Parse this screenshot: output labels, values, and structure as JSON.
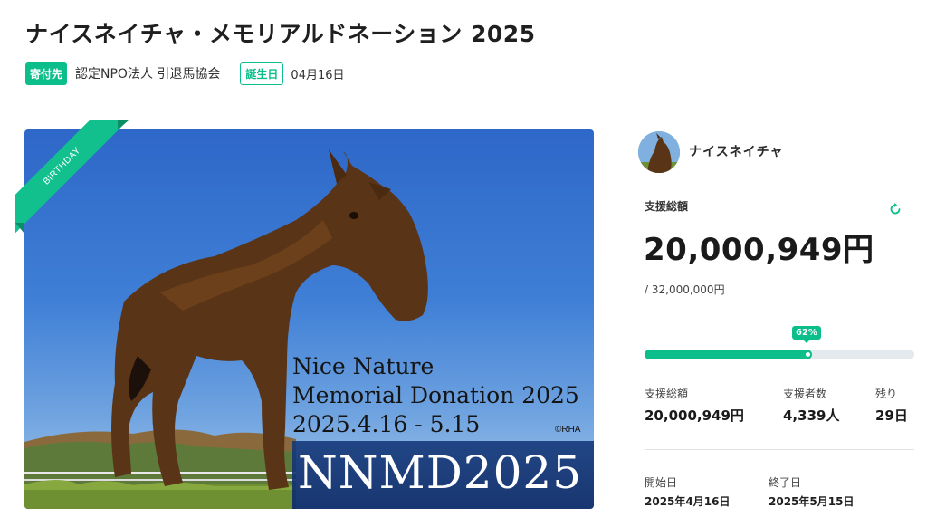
{
  "page": {
    "title": "ナイスネイチャ・メモリアルドネーション 2025"
  },
  "meta": {
    "recipient_badge": "寄付先",
    "recipient_name": "認定NPO法人 引退馬協会",
    "birthday_badge": "誕生日",
    "birthday_date": "04月16日"
  },
  "hero": {
    "ribbon_text": "BIRTHDAY",
    "overlay_line1": "Nice Nature",
    "overlay_line2": "Memorial Donation 2025",
    "overlay_line3": "2025.4.16 - 5.15",
    "copyright": "©RHA",
    "logo_text": "NNMD2025"
  },
  "sidebar": {
    "horse_name": "ナイスネイチャ",
    "total_label": "支援総額",
    "total_amount": "20,000,949円",
    "target_amount": "/ 32,000,000円",
    "progress_label": "62%",
    "progress_fraction": 0.62,
    "stats": [
      {
        "label": "支援総額",
        "value": "20,000,949円"
      },
      {
        "label": "支援者数",
        "value": "4,339人"
      },
      {
        "label": "残り",
        "value": "29日"
      }
    ],
    "start_label": "開始日",
    "start_date": "2025年4月16日",
    "end_label": "終了日",
    "end_date": "2025年5月15日"
  },
  "colors": {
    "accent": "#0cbf8a",
    "progress_track": "#e4e9ee",
    "logo_band": "#143778"
  },
  "icons": {
    "refresh": "refresh-icon"
  }
}
